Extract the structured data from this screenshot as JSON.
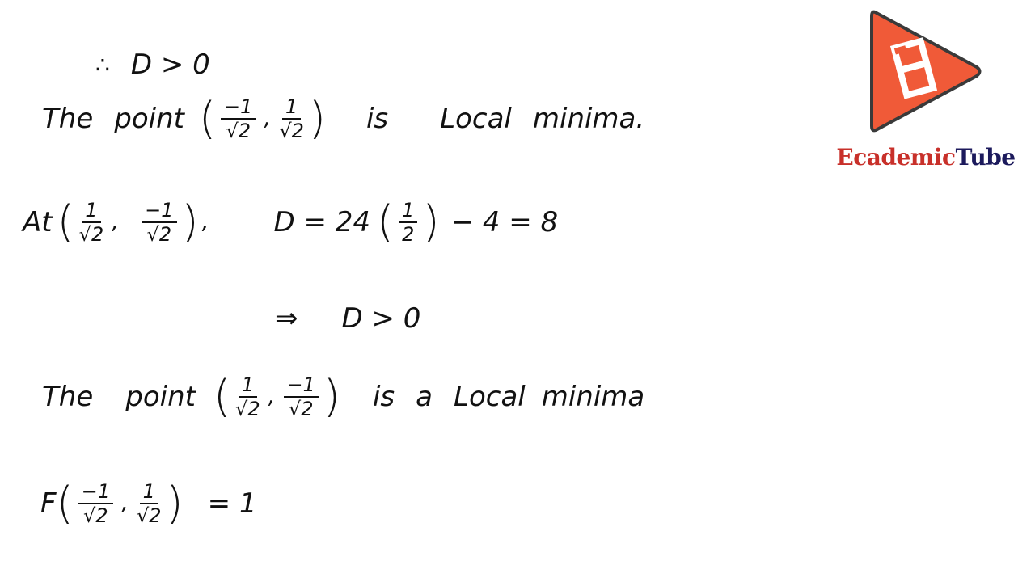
{
  "logo": {
    "icon": "play-triangle-logo-icon",
    "brand_part1": "Ecademic",
    "brand_part2": "Tube",
    "colors": {
      "triangle": "#f05a38",
      "triangle_border": "#3a3a3a",
      "brand_red": "#c8302a",
      "brand_navy": "#1c1a5c"
    }
  },
  "lines": {
    "l1": {
      "therefore": "∴",
      "expr": "D > 0"
    },
    "l2": {
      "words": [
        "The",
        "point"
      ],
      "point": {
        "x_num": "−1",
        "x_den": "√2",
        "y_num": "1",
        "y_den": "√2"
      },
      "tail": [
        "is",
        "Local",
        "minima."
      ]
    },
    "l3": {
      "prefix": "At",
      "point": {
        "x_num": "1",
        "x_den": "√2",
        "y_num": "−1",
        "y_den": "√2"
      },
      "eq_lhs": "D = 24",
      "half_num": "1",
      "half_den": "2",
      "eq_rhs": "− 4 = 8"
    },
    "l4": {
      "implies": "⇒",
      "expr": "D > 0"
    },
    "l5": {
      "words": [
        "The",
        "point"
      ],
      "point": {
        "x_num": "1",
        "x_den": "√2",
        "y_num": "−1",
        "y_den": "√2"
      },
      "tail": [
        "is",
        "a",
        "Local",
        "minima"
      ]
    },
    "l6": {
      "func": "F",
      "point": {
        "x_num": "−1",
        "x_den": "√2",
        "y_num": "1",
        "y_den": "√2"
      },
      "rhs": "= 1"
    }
  }
}
